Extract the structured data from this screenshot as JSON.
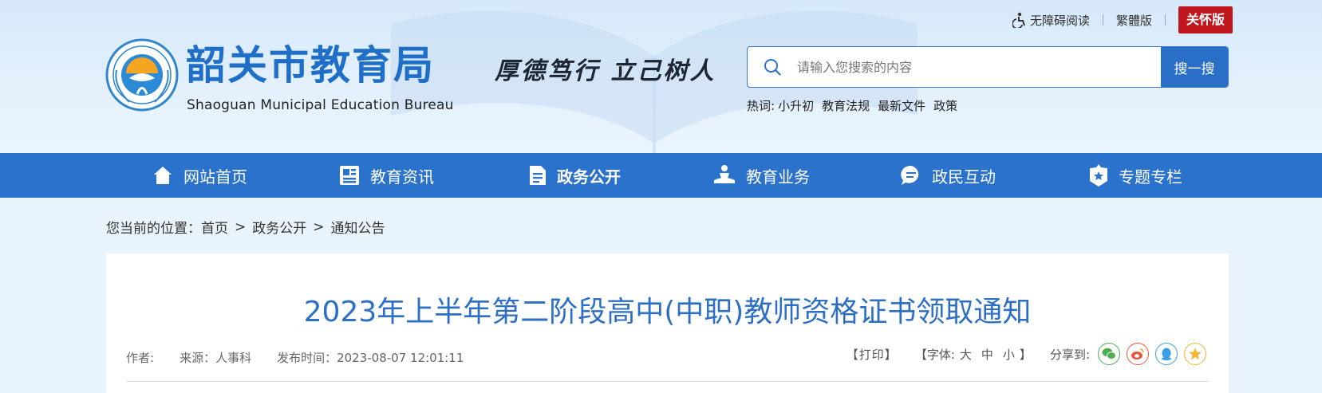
{
  "toplinks": {
    "accessibility": "无障碍阅读",
    "traditional": "繁體版",
    "care": "关怀版"
  },
  "brand": {
    "title": "韶关市教育局",
    "subtitle": "Shaoguan Municipal Education Bureau",
    "motto": "厚德笃行  立己树人",
    "colors": {
      "primary": "#2b72cd",
      "care": "#c0161d"
    }
  },
  "search": {
    "placeholder": "请输入您搜索的内容",
    "value": "",
    "button": "搜一搜"
  },
  "hotwords": {
    "label": "热词:",
    "items": [
      "小升初",
      "教育法规",
      "最新文件",
      "政策"
    ]
  },
  "nav": {
    "items": [
      {
        "label": "网站首页",
        "icon": "home-icon"
      },
      {
        "label": "教育资讯",
        "icon": "newspaper-icon"
      },
      {
        "label": "政务公开",
        "icon": "document-icon"
      },
      {
        "label": "教育业务",
        "icon": "service-icon"
      },
      {
        "label": "政民互动",
        "icon": "chat-icon"
      },
      {
        "label": "专题专栏",
        "icon": "badge-icon"
      }
    ],
    "active": "政务公开"
  },
  "breadcrumb": {
    "prefix": "您当前的位置：",
    "items": [
      "首页",
      "政务公开",
      "通知公告"
    ],
    "separator": ">"
  },
  "article": {
    "title": "2023年上半年第二阶段高中(中职)教师资格证书领取通知",
    "author": "作者:",
    "source": "来源：人事科",
    "published": "发布时间：2023-08-07 12:01:11",
    "print": "【打印】",
    "font_label": "【字体:",
    "font_large": "大",
    "font_medium": "中",
    "font_small": "小",
    "font_close": "】",
    "share_label": "分享到:",
    "share_icons": [
      "wechat-icon",
      "weibo-icon",
      "qq-icon",
      "qzone-icon"
    ]
  }
}
